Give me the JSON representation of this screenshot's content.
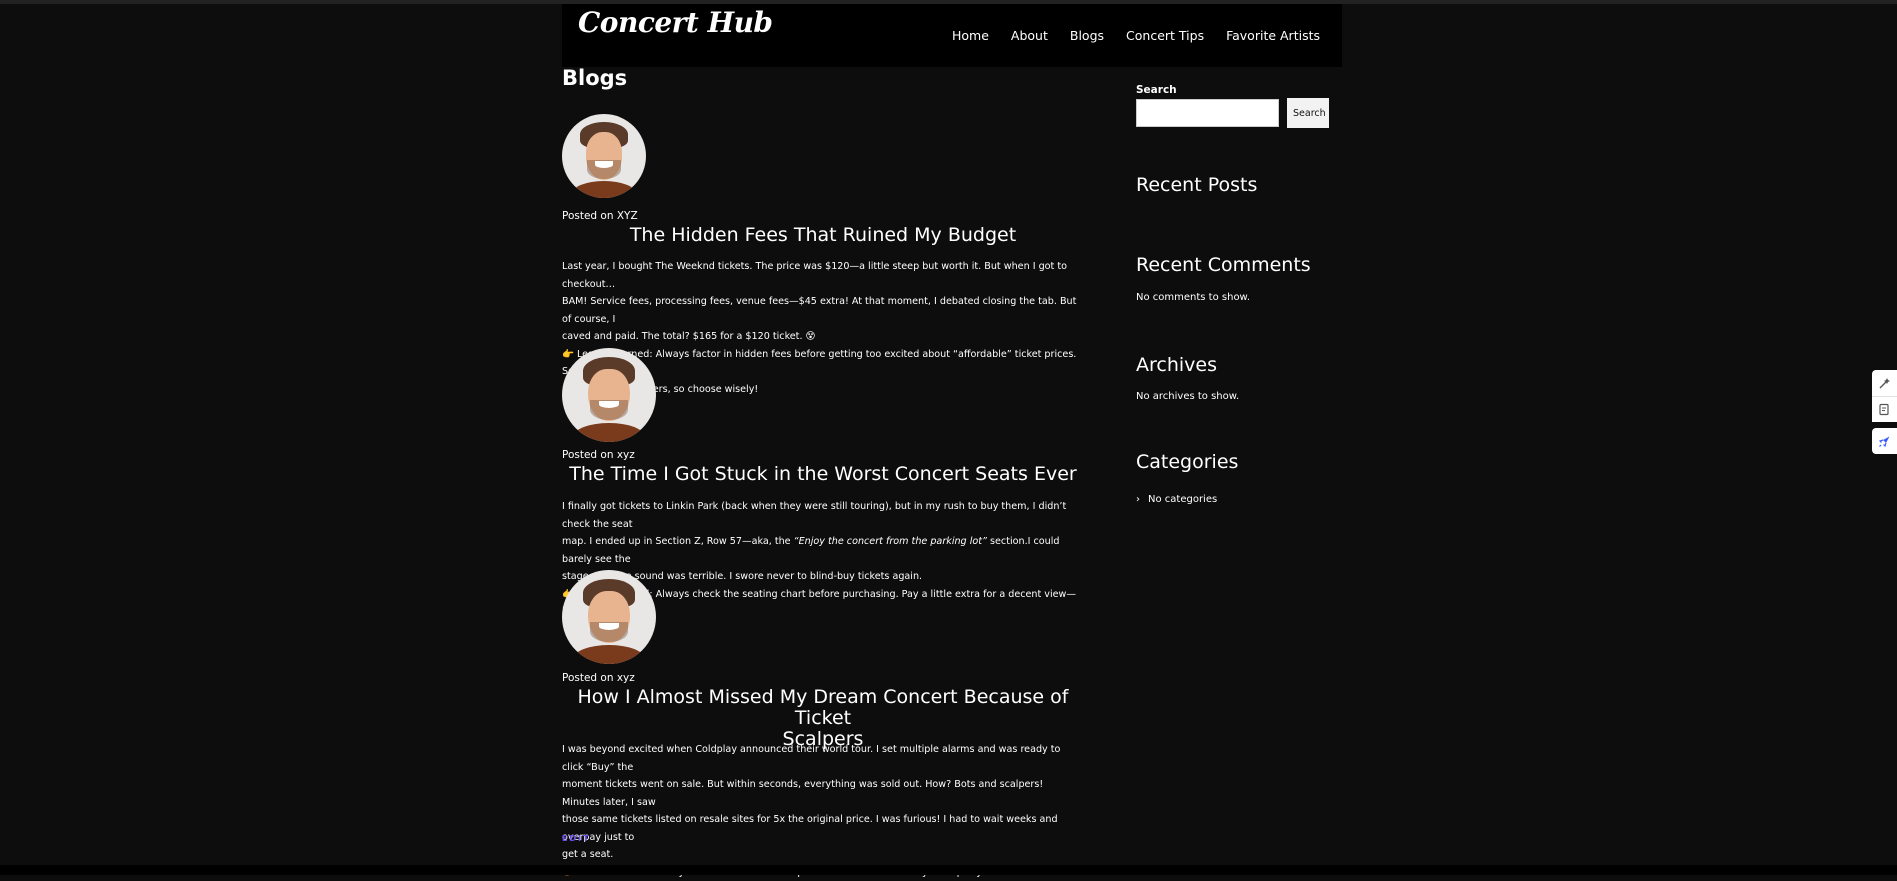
{
  "site": {
    "logo": "Concert Hub"
  },
  "nav": [
    "Home",
    "About",
    "Blogs",
    "Concert Tips",
    "Favorite Artists"
  ],
  "page_title": "Blogs",
  "posts": [
    {
      "posted_on": "Posted on XYZ",
      "title_line1": "The Hidden Fees That Ruined My Budget",
      "title_line2": "",
      "body": [
        "Last year, I bought The Weeknd tickets. The price was $120—a little steep but worth it. But when I got to checkout…",
        "BAM! Service fees, processing fees, venue fees—$45 extra! At that moment, I debated closing the tab. But of course, I",
        "caved and paid. The total? $165 for a $120 ticket. 😵",
        "👉 Lesson learned: Always factor in hidden fees before getting too excited about “affordable” ticket prices. Some sites",
        "are worse than others, so choose wisely!"
      ]
    },
    {
      "posted_on": "Posted on xyz",
      "title_line1": "The Time I Got Stuck in the Worst Concert Seats Ever",
      "title_line2": "",
      "body_line1": "I finally got tickets to Linkin Park (back when they were still touring), but in my rush to buy them, I didn’t check the seat",
      "body_line2_a": "map. I ended up in Section Z, Row 57—aka, the ",
      "body_line2_em": "“Enjoy the concert from the parking lot”",
      "body_line2_b": " section.I could barely see the",
      "body_line3": "stage, and the sound was terrible. I swore never to blind-buy tickets again.",
      "body_line4": "👉 Lesson learned: Always check the seating chart before purchasing. Pay a little extra for a decent view—it’s worth it!"
    },
    {
      "posted_on": "Posted on xyz",
      "title_line1": "How I Almost Missed My Dream Concert Because of Ticket",
      "title_line2": "Scalpers",
      "body": [
        "I was beyond excited when Coldplay announced their world tour. I set multiple alarms and was ready to click “Buy” the",
        "moment tickets went on sale. But within seconds, everything was sold out. How? Bots and scalpers! Minutes later, I saw",
        "those same tickets listed on resale sites for 5x the original price. I was furious! I had to wait weeks and overpay just to",
        "get a seat.",
        "👉 Lesson learned: Always check for verified fan presales and avoid sketchy third-party sellers."
      ]
    }
  ],
  "edit_label": "EDIT",
  "sidebar": {
    "search_label": "Search",
    "search_button": "Search",
    "search_value": "",
    "recent_posts": "Recent Posts",
    "recent_comments": "Recent Comments",
    "no_comments": "No comments to show.",
    "archives": "Archives",
    "no_archives": "No archives to show.",
    "categories": "Categories",
    "no_categories": "No categories"
  },
  "icons": {
    "avatar": "person-avatar",
    "chevron": "chevron-right-icon",
    "tool1": "magic-wand-icon",
    "tool2": "document-edit-icon",
    "tool3": "rocket-icon"
  },
  "colors": {
    "background": "#0d0d0d",
    "header": "#000000",
    "edit_link": "#6a4cf0",
    "accent_tool": "#3a5bff"
  }
}
